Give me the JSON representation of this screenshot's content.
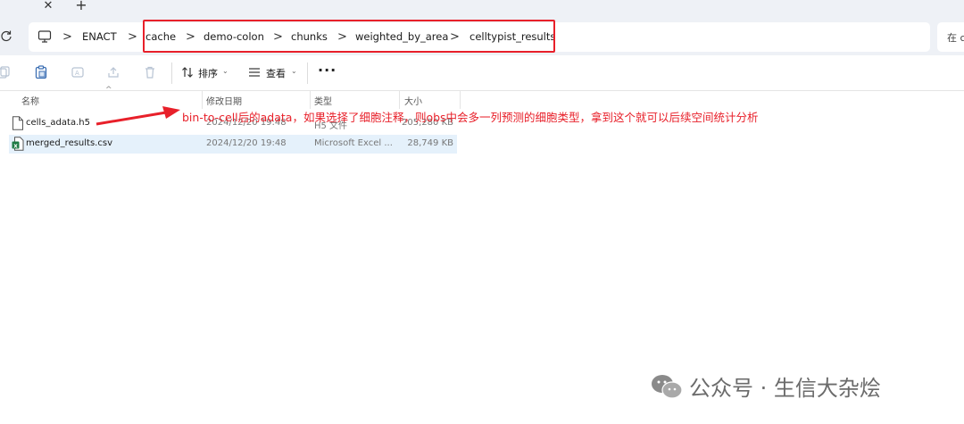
{
  "tabs": {
    "close_symbol": "✕",
    "new_symbol": "+"
  },
  "address": {
    "separator": ">",
    "crumbs": [
      "ENACT",
      "cache",
      "demo-colon",
      "chunks",
      "weighted_by_area",
      "celltypist_results"
    ],
    "search_prefix": "在 c",
    "highlight_color": "#e8202a"
  },
  "toolbar": {
    "sort_label": "排序",
    "view_label": "查看",
    "more_label": "···"
  },
  "columns": {
    "name": "名称",
    "modified": "修改日期",
    "type": "类型",
    "size": "大小"
  },
  "files": [
    {
      "name": "cells_adata.h5",
      "modified": "2024/12/20 19:48",
      "type": "H5 文件",
      "size": "205,280 KB",
      "icon": "file-icon",
      "selected": false
    },
    {
      "name": "merged_results.csv",
      "modified": "2024/12/20 19:48",
      "type": "Microsoft Excel ...",
      "size": "28,749 KB",
      "icon": "excel-csv-icon",
      "selected": true
    }
  ],
  "annotation": {
    "text": "bin-to-cell后的adata，如果选择了细胞注释，则obs中会多一列预测的细胞类型，拿到这个就可以后续空间统计分析",
    "color": "#e8202a"
  },
  "watermark": {
    "text": "公众号 · 生信大杂烩"
  }
}
